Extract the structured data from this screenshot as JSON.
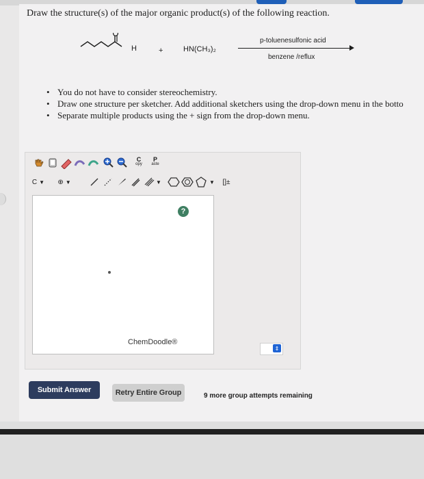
{
  "question": {
    "title": "Draw the structure(s) of the major organic product(s) of the following reaction."
  },
  "reaction": {
    "aldehyde_label": "H",
    "plus": "+",
    "amine": "HN(CH₃)₂",
    "condition_top": "p-toluenesulfonic acid",
    "condition_bottom": "benzene /reflux"
  },
  "bullets": [
    "You do not have to consider stereochemistry.",
    "Draw one structure per sketcher. Add additional sketchers using the drop-down menu in the botto",
    "Separate multiple products using the + sign from the drop-down menu."
  ],
  "sketcher": {
    "copy_top": "C",
    "copy_bottom": "opy",
    "paste_top": "P",
    "paste_bottom": "aste",
    "element_selector": "C",
    "charge_button": "⊕",
    "brackets_button": "[]±",
    "help_label": "?",
    "watermark": "ChemDoodle®"
  },
  "actions": {
    "submit_label": "Submit Answer",
    "retry_label": "Retry Entire Group",
    "attempts_text": "9 more group attempts remaining"
  },
  "colors": {
    "submit_bg": "#2d3c5e",
    "retry_bg": "#cfcfcf",
    "help_bg": "#3f7f62",
    "dropdown_btn": "#1f64d5"
  }
}
